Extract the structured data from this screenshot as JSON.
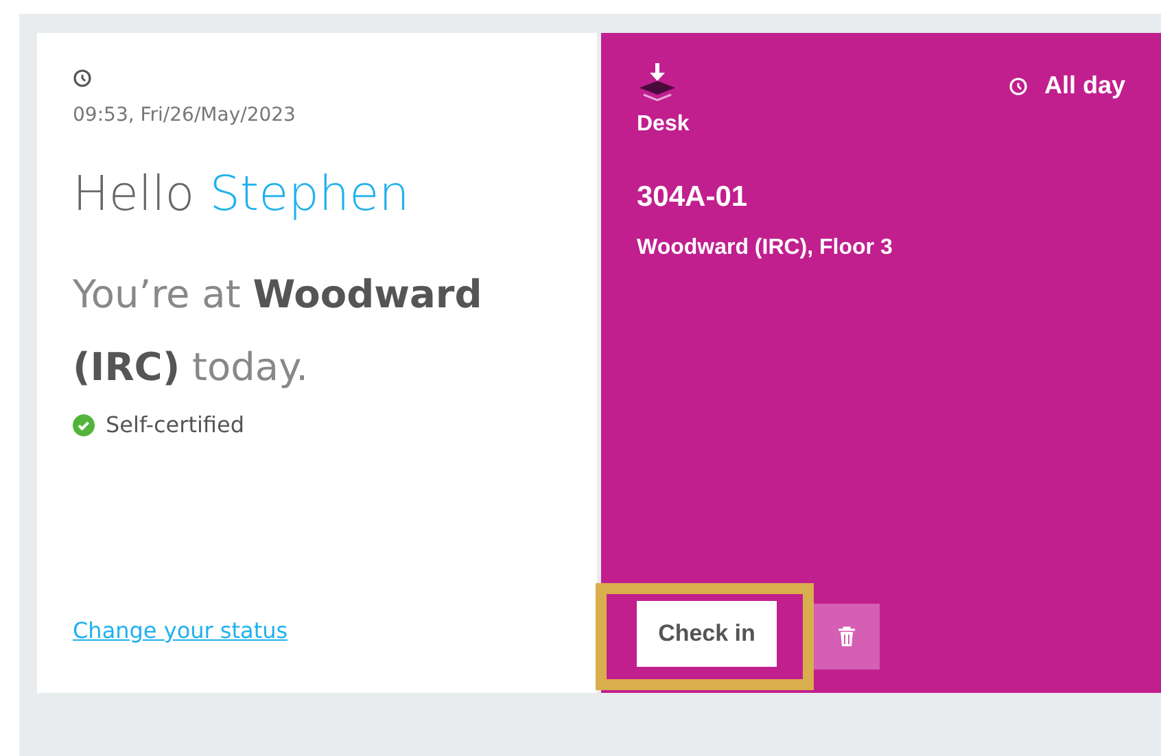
{
  "welcome": {
    "datetime": "09:53, Fri/26/May/2023",
    "greeting": "Hello",
    "name": "Stephen",
    "location_sentence": "You’re at **Woodward (IRC)** today.",
    "status": "Self-certified",
    "status_ok": true,
    "change_link": "Change your status"
  },
  "booking": {
    "type": "Desk",
    "duration": "All day",
    "desk_id": "304A-01",
    "location": "Woodward (IRC), Floor 3",
    "check_in_button": "Check in",
    "highlighted": true
  }
}
